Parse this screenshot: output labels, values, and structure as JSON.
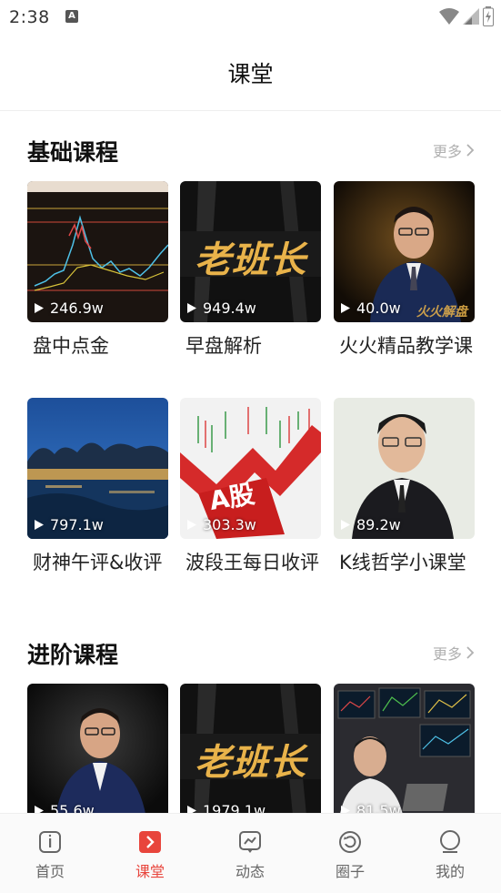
{
  "status_bar": {
    "time": "2:38",
    "notification_letter": "A"
  },
  "header": {
    "title": "课堂"
  },
  "sections": [
    {
      "title": "基础课程",
      "more_label": "更多",
      "courses": [
        {
          "title": "盘中点金",
          "plays": "246.9w",
          "thumb": "chart"
        },
        {
          "title": "早盘解析",
          "plays": "949.4w",
          "thumb": "laobanzhang"
        },
        {
          "title": "火火精品教学课",
          "plays": "40.0w",
          "thumb": "man-suit",
          "overlay_text": "火火解盘"
        },
        {
          "title": "财神午评&收评",
          "plays": "797.1w",
          "thumb": "city-night"
        },
        {
          "title": "波段王每日收评",
          "plays": "303.3w",
          "thumb": "a-share",
          "overlay_text": "A股"
        },
        {
          "title": "K线哲学小课堂",
          "plays": "89.2w",
          "thumb": "man-portrait"
        }
      ]
    },
    {
      "title": "进阶课程",
      "more_label": "更多",
      "courses": [
        {
          "title": "",
          "plays": "55.6w",
          "thumb": "man-suit-dark"
        },
        {
          "title": "",
          "plays": "1979.1w",
          "thumb": "laobanzhang"
        },
        {
          "title": "",
          "plays": "81.5w",
          "thumb": "trading-desk"
        }
      ]
    }
  ],
  "banner_text": "老班长",
  "tabs": [
    {
      "label": "首页",
      "icon": "home-icon",
      "active": false
    },
    {
      "label": "课堂",
      "icon": "classroom-icon",
      "active": true
    },
    {
      "label": "动态",
      "icon": "feed-icon",
      "active": false
    },
    {
      "label": "圈子",
      "icon": "circle-icon",
      "active": false
    },
    {
      "label": "我的",
      "icon": "profile-icon",
      "active": false
    }
  ],
  "colors": {
    "accent": "#e8453c",
    "gold": "#e9b34a",
    "muted": "#b0b0b0"
  }
}
